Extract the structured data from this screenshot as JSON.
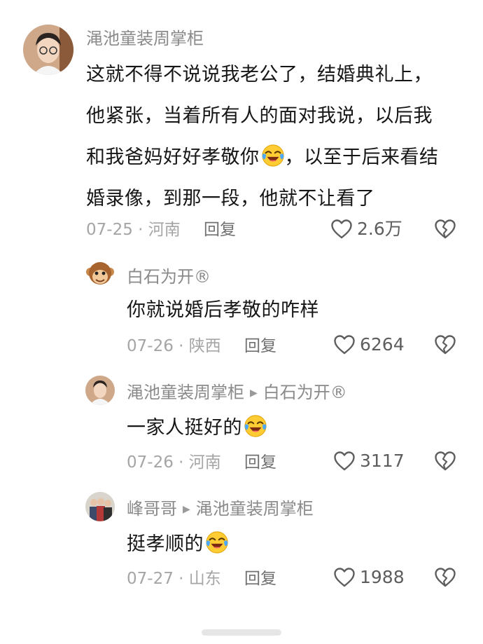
{
  "comments": [
    {
      "author": "渑池童装周掌柜",
      "reply_to": "",
      "text_lines": [
        "这就不得不说说我老公了，结婚典礼上，",
        "他紧张，当着所有人的面对我说，以后我",
        "和我爸妈好好孝敬你",
        "，以至于后来看结",
        "婚录像，到那一段，他就不让看了"
      ],
      "meta": "07-25 · 河南",
      "reply_label": "回复",
      "likes": "2.6万"
    },
    {
      "author": "白石为开®",
      "reply_to": "",
      "text": "你就说婚后孝敬的咋样",
      "meta": "07-26 · 陕西",
      "reply_label": "回复",
      "likes": "6264"
    },
    {
      "author": "渑池童装周掌柜",
      "reply_to": "白石为开®",
      "text": "一家人挺好的",
      "meta": "07-26 · 河南",
      "reply_label": "回复",
      "likes": "3117"
    },
    {
      "author": "峰哥哥",
      "reply_to": "渑池童装周掌柜",
      "text": "挺孝顺的",
      "meta": "07-27 · 山东",
      "reply_label": "回复",
      "likes": "1988"
    }
  ],
  "icons": {
    "emoji": "laughing-crying-emoji",
    "like": "heart-outline-icon",
    "dislike": "broken-heart-icon",
    "reply_arrow": "triangle-right-icon"
  },
  "colors": {
    "name": "#8a8a8a",
    "meta": "#a5a5a5",
    "text": "#161616",
    "icon": "#5e5e5e"
  }
}
